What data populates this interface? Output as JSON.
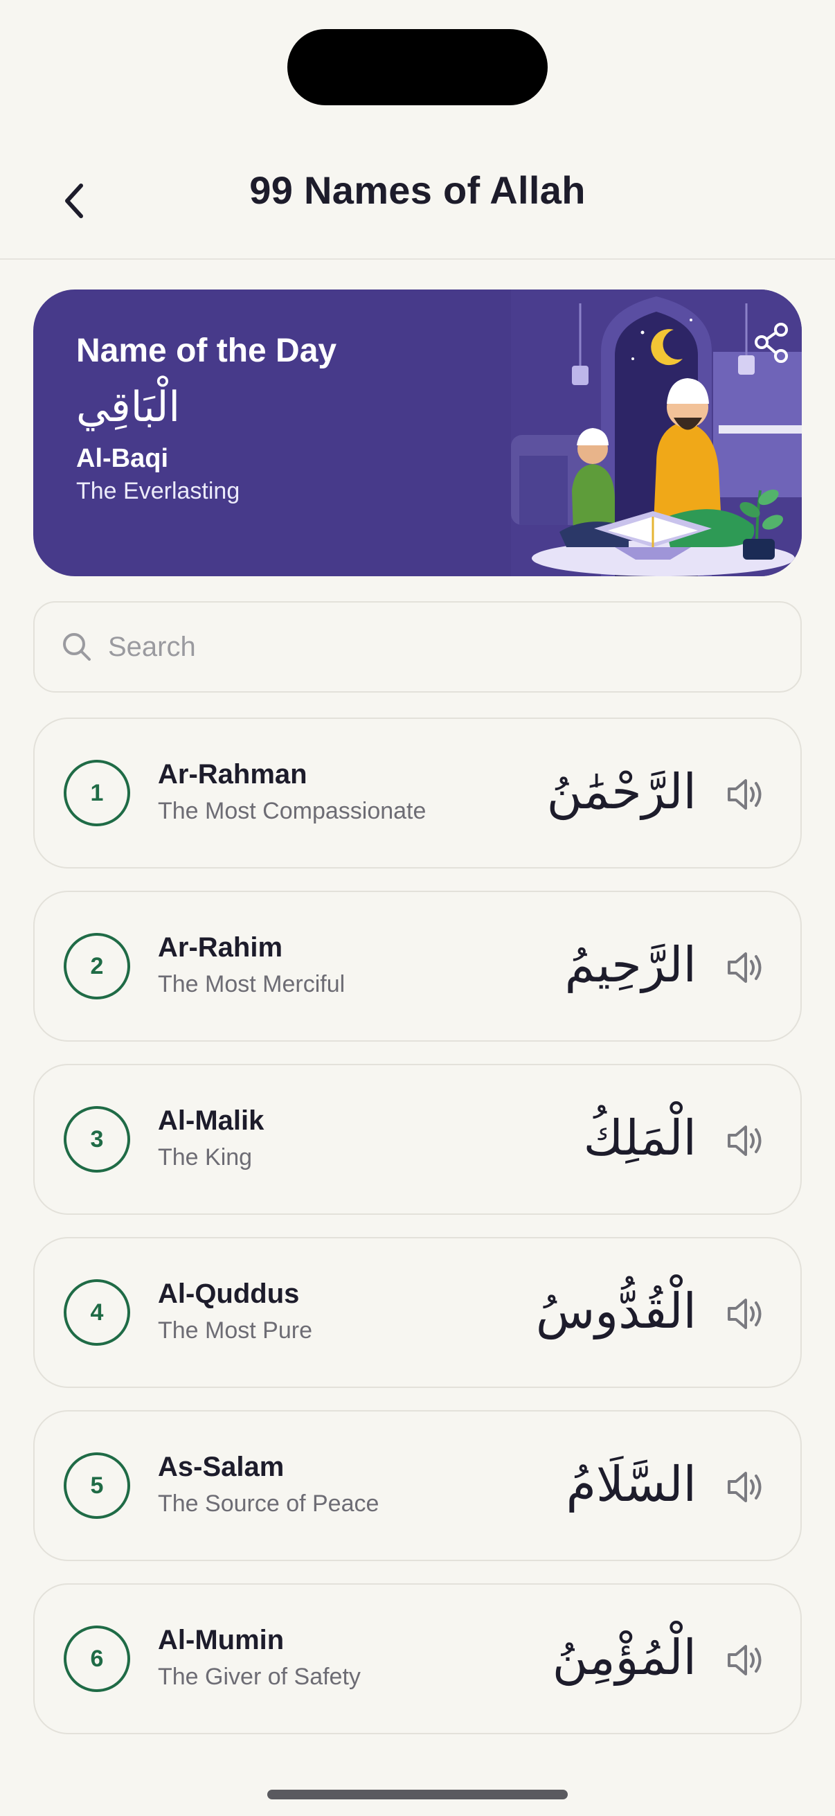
{
  "header": {
    "title": "99 Names of Allah"
  },
  "name_of_the_day": {
    "heading": "Name of the Day",
    "arabic": "الْبَاقِي",
    "transliteration": "Al-Baqi",
    "meaning": "The Everlasting"
  },
  "search": {
    "placeholder": "Search"
  },
  "names": [
    {
      "number": "1",
      "transliteration": "Ar-Rahman",
      "meaning": "The Most Compassionate",
      "arabic": "الرَّحْمَٰنُ"
    },
    {
      "number": "2",
      "transliteration": "Ar-Rahim",
      "meaning": "The Most Merciful",
      "arabic": "الرَّحِيمُ"
    },
    {
      "number": "3",
      "transliteration": "Al-Malik",
      "meaning": "The King",
      "arabic": "الْمَلِكُ"
    },
    {
      "number": "4",
      "transliteration": "Al-Quddus",
      "meaning": "The Most Pure",
      "arabic": "الْقُدُّوسُ"
    },
    {
      "number": "5",
      "transliteration": "As-Salam",
      "meaning": "The Source of Peace",
      "arabic": "السَّلَامُ"
    },
    {
      "number": "6",
      "transliteration": "Al-Mumin",
      "meaning": "The Giver of Safety",
      "arabic": "الْمُؤْمِنُ"
    }
  ],
  "colors": {
    "background": "#f7f6f1",
    "hero_background": "#473a8a",
    "accent_green": "#1f6b46",
    "text_primary": "#1d1c2b",
    "text_secondary": "#6d6c74"
  },
  "icons": {
    "back": "chevron-left-icon",
    "search": "search-icon",
    "play_audio": "speaker-icon",
    "share": "share-icon"
  }
}
